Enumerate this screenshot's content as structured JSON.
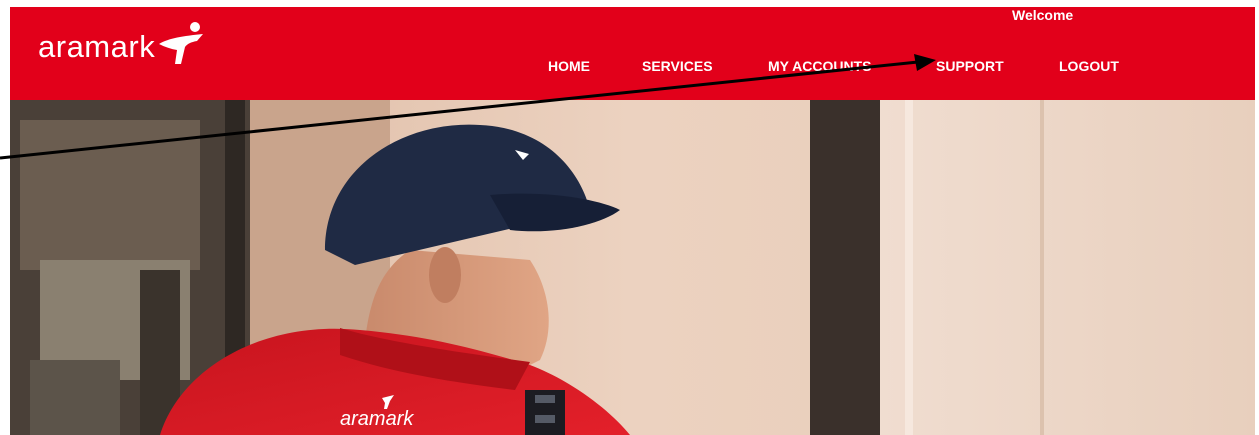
{
  "brand": {
    "logo_text": "aramark",
    "primary_color": "#e2001a",
    "text_color": "#ffffff"
  },
  "header": {
    "welcome_text": "Welcome",
    "nav": {
      "home": "HOME",
      "services": "SERVICES",
      "accounts": "MY ACCOUNTS",
      "support": "SUPPORT",
      "logout": "LOGOUT"
    }
  },
  "hero": {
    "uniform_logo_text": "aramark",
    "image_subject": "worker-in-cap-and-red-jacket"
  },
  "annotation": {
    "type": "arrow",
    "color": "#000000",
    "target": "support-nav-link"
  }
}
